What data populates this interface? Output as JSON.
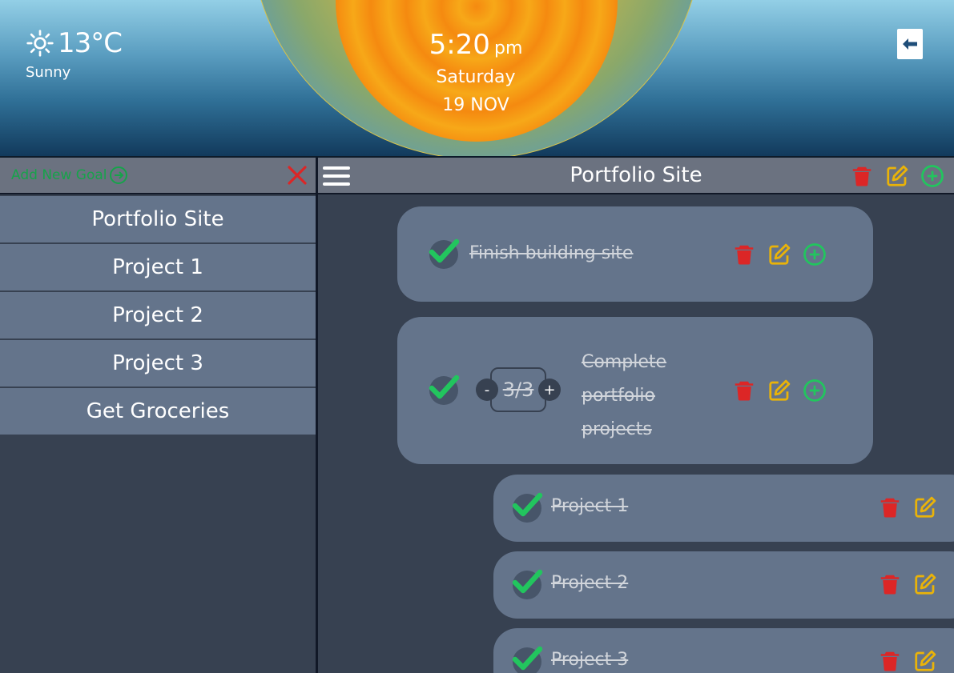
{
  "weather": {
    "icon": "sun-icon",
    "temperature": "13°C",
    "condition": "Sunny"
  },
  "clock": {
    "time": "5:20",
    "ampm": "pm",
    "day": "Saturday",
    "date": "19 NOV"
  },
  "sidebar": {
    "add_goal_label": "Add New Goal",
    "goals": [
      {
        "label": "Portfolio Site"
      },
      {
        "label": "Project 1"
      },
      {
        "label": "Project 2"
      },
      {
        "label": "Project 3"
      },
      {
        "label": "Get Groceries"
      }
    ]
  },
  "main": {
    "title": "Portfolio Site",
    "tasks": [
      {
        "text": "Finish building site",
        "completed": true
      },
      {
        "text_lines": [
          "Complete",
          "portfolio",
          "projects"
        ],
        "completed": true,
        "counter": "3/3",
        "minus": "-",
        "plus": "+"
      }
    ],
    "subtasks": [
      {
        "text": "Project 1",
        "completed": true
      },
      {
        "text": "Project 2",
        "completed": true
      },
      {
        "text": "Project 3",
        "completed": true
      }
    ]
  },
  "colors": {
    "delete": "#dc2626",
    "edit": "#eab308",
    "add": "#22c55e",
    "check": "#22c55e",
    "panel": "#64748b",
    "background": "#374151"
  }
}
